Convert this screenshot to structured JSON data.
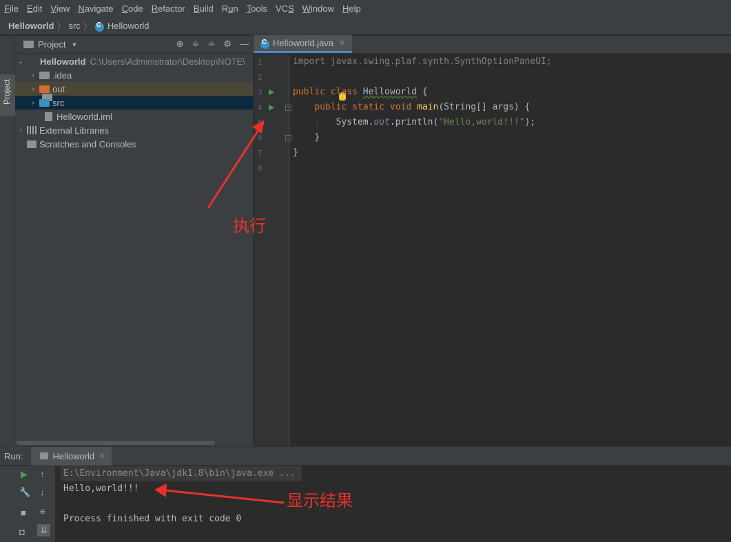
{
  "menu": [
    {
      "pre": "",
      "u": "F",
      "post": "ile"
    },
    {
      "pre": "",
      "u": "E",
      "post": "dit"
    },
    {
      "pre": "",
      "u": "V",
      "post": "iew"
    },
    {
      "pre": "",
      "u": "N",
      "post": "avigate"
    },
    {
      "pre": "",
      "u": "C",
      "post": "ode"
    },
    {
      "pre": "",
      "u": "R",
      "post": "efactor"
    },
    {
      "pre": "",
      "u": "B",
      "post": "uild"
    },
    {
      "pre": "R",
      "u": "u",
      "post": "n"
    },
    {
      "pre": "",
      "u": "T",
      "post": "ools"
    },
    {
      "pre": "VC",
      "u": "S",
      "post": ""
    },
    {
      "pre": "",
      "u": "W",
      "post": "indow"
    },
    {
      "pre": "",
      "u": "H",
      "post": "elp"
    }
  ],
  "breadcrumb": {
    "project": "Helloworld",
    "folder": "src",
    "file": "Helloworld"
  },
  "sidebar_tab": "Project",
  "project_panel": {
    "title": "Project",
    "root_name": "Helloworld",
    "root_path": "C:\\Users\\Administrator\\Desktop\\NOTE\\",
    "items": [
      {
        "name": ".idea"
      },
      {
        "name": "out"
      },
      {
        "name": "src"
      },
      {
        "name": "Helloworld.iml"
      },
      {
        "name": "External Libraries"
      },
      {
        "name": "Scratches and Consoles"
      }
    ]
  },
  "editor": {
    "tab": "Helloworld.java",
    "line_numbers": [
      "1",
      "2",
      "3",
      "4",
      "5",
      "6",
      "7",
      "8"
    ],
    "lines": {
      "l1": "import javax.swing.plaf.synth.SynthOptionPaneUI;",
      "l3a": "public class ",
      "l3b": "Helloworld",
      "l3c": " {",
      "l4a": "    public static void ",
      "l4b": "main",
      "l4c": "(String[] args) {",
      "l5a": "        System.",
      "l5b": "out",
      "l5c": ".println(",
      "l5d": "\"Hello,world!!!\"",
      "l5e": ");",
      "l6": "    }",
      "l7": "}"
    }
  },
  "run_panel": {
    "label": "Run:",
    "tab": "Helloworld",
    "console": [
      "E:\\Environment\\Java\\jdk1.8\\bin\\java.exe ...",
      "Hello,world!!!",
      "",
      "Process finished with exit code 0"
    ]
  },
  "annotations": {
    "execute": "执行",
    "show_result": "显示结果"
  },
  "colors": {
    "annotation": "#e8312c",
    "keyword": "#cc7832",
    "string": "#6a8759",
    "run_green": "#499c54"
  }
}
